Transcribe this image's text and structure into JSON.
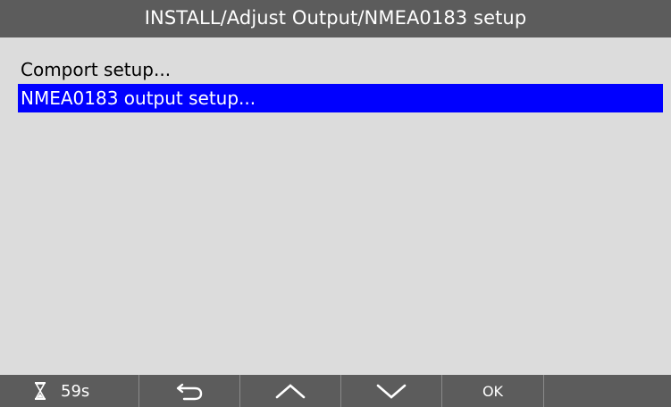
{
  "header": {
    "title": "INSTALL/Adjust Output/NMEA0183 setup"
  },
  "menu": {
    "items": [
      {
        "label": "Comport setup...",
        "selected": false
      },
      {
        "label": "NMEA0183 output setup...",
        "selected": true
      }
    ]
  },
  "softkeys": {
    "timer": {
      "icon": "hourglass-icon",
      "value": "59s"
    },
    "back": {
      "icon": "back-arrow-icon"
    },
    "up": {
      "icon": "chevron-up-icon"
    },
    "down": {
      "icon": "chevron-down-icon"
    },
    "ok": {
      "label": "OK"
    },
    "blank": {
      "label": ""
    }
  },
  "colors": {
    "title_bar": "#5c5c5c",
    "content_bg": "#dcdcdc",
    "selection": "#0000ff",
    "selection_text": "#ffffff",
    "text": "#000000",
    "softkey_bar": "#5c5c5c"
  }
}
